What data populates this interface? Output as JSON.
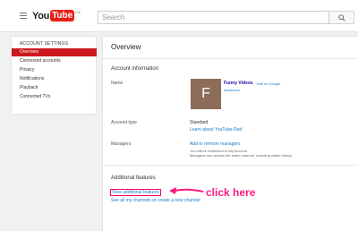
{
  "header": {
    "logo_you": "You",
    "logo_tube": "Tube",
    "logo_region": "CA",
    "search_placeholder": "Search"
  },
  "sidebar": {
    "heading": "ACCOUNT SETTINGS",
    "items": [
      {
        "label": "Overview",
        "active": true
      },
      {
        "label": "Connected accounts",
        "active": false
      },
      {
        "label": "Privacy",
        "active": false
      },
      {
        "label": "Notifications",
        "active": false
      },
      {
        "label": "Playback",
        "active": false
      },
      {
        "label": "Connected TVs",
        "active": false
      }
    ]
  },
  "main": {
    "title": "Overview",
    "account_info_heading": "Account information",
    "name_label": "Name",
    "avatar_letter": "F",
    "channel_name": "Funny Videos",
    "edit_on_google": "Edit on Google",
    "advanced": "Advanced",
    "account_type_label": "Account type",
    "account_type_value": "Standard",
    "learn_more": "Learn about YouTube Red",
    "managers_label": "Managers",
    "add_remove_managers": "Add or remove managers",
    "managers_note_1": "You will be redirected to My Account",
    "managers_note_2": "Managers can access the entire channel, including watch history.",
    "additional_heading": "Additional features",
    "view_additional": "View additional features",
    "see_all_channels": "See all my channels or create a new channel"
  },
  "annotation": {
    "text": "click here",
    "color": "#ff1a7a"
  },
  "colors": {
    "brand_red": "#cc181e",
    "link_blue": "#167ac6",
    "avatar_bg": "#8c6d5a"
  }
}
